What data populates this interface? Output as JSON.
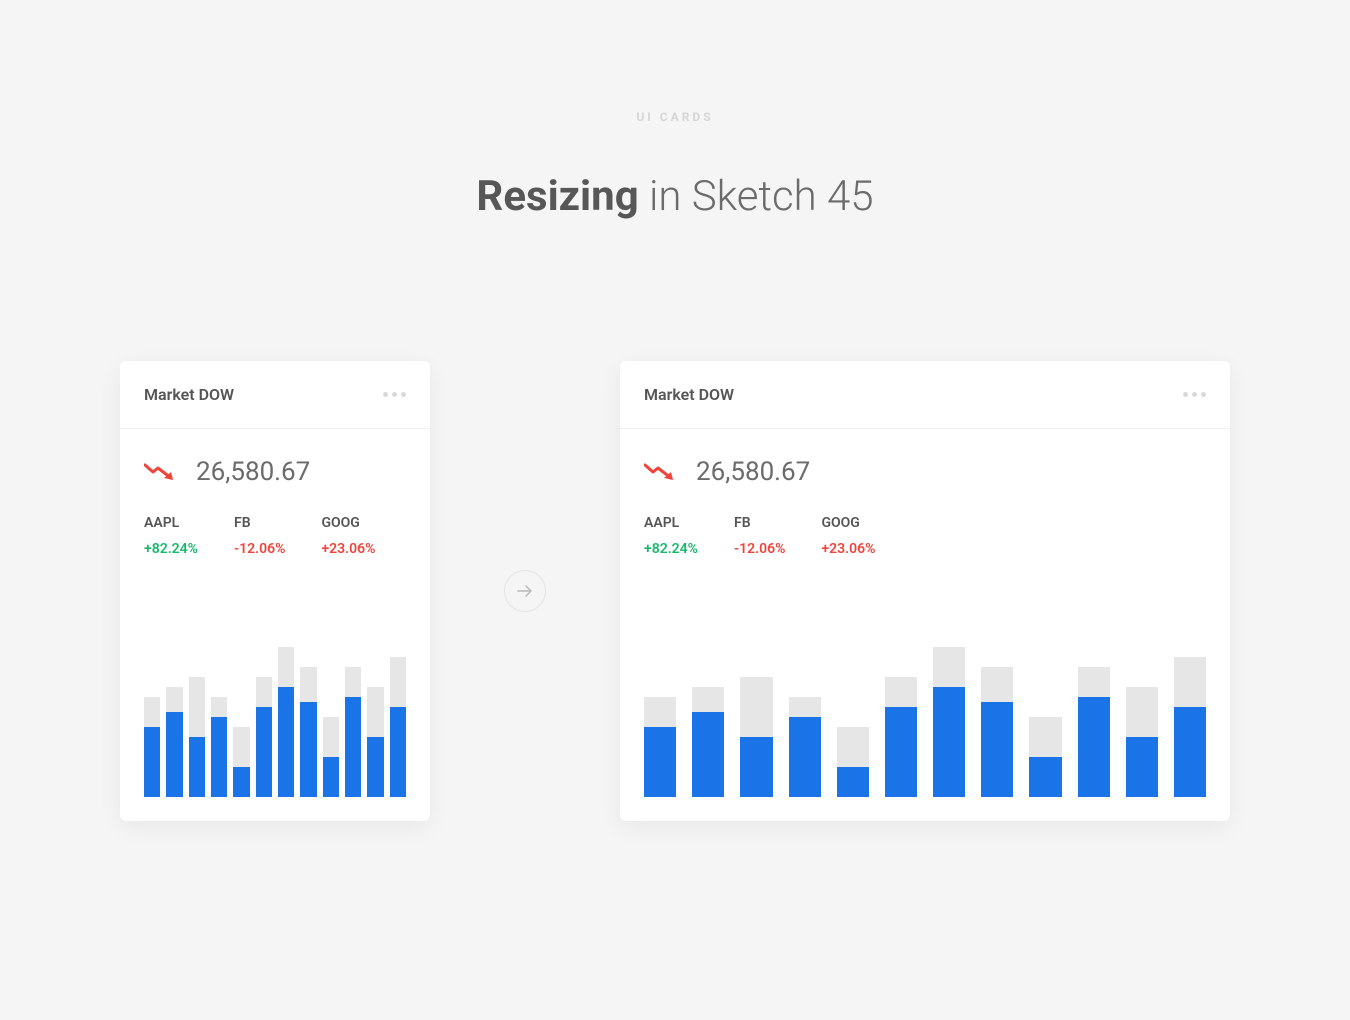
{
  "eyebrow": "UI CARDS",
  "title_bold": "Resizing",
  "title_rest": " in Sketch 45",
  "card": {
    "title": "Market DOW",
    "index_value": "26,580.67",
    "stocks": [
      {
        "ticker": "AAPL",
        "change": "+82.24%",
        "dir": "up"
      },
      {
        "ticker": "FB",
        "change": "-12.06%",
        "dir": "down"
      },
      {
        "ticker": "GOOG",
        "change": "+23.06%",
        "dir": "down"
      }
    ]
  },
  "chart_data": {
    "type": "bar",
    "title": "Market DOW",
    "ylim": [
      0,
      160
    ],
    "note": "values are pixel-height estimates read from an unlabeled bar chart; total = gray background bar, value = blue foreground bar",
    "series": [
      {
        "name": "blue",
        "values": [
          70,
          85,
          60,
          80,
          30,
          90,
          110,
          95,
          40,
          100,
          60,
          90
        ]
      },
      {
        "name": "gray_total",
        "values": [
          100,
          110,
          120,
          100,
          70,
          120,
          150,
          130,
          80,
          130,
          110,
          140
        ]
      }
    ]
  }
}
